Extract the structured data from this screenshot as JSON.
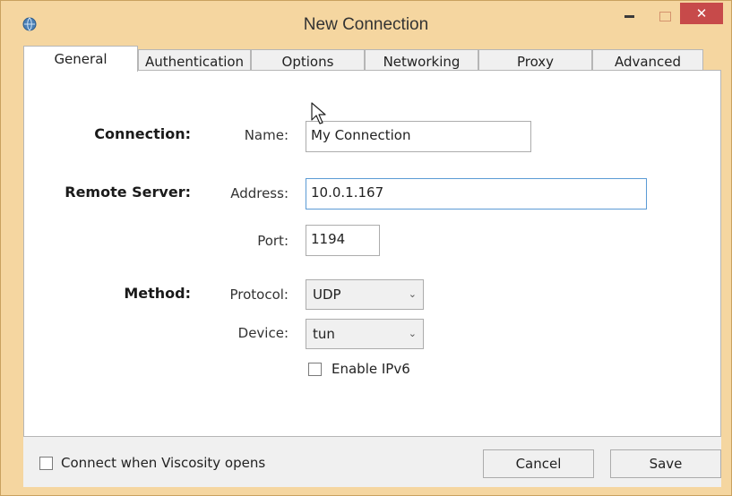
{
  "window": {
    "title": "New Connection",
    "close_glyph": "✕"
  },
  "tabs": [
    {
      "label": "General",
      "active": true
    },
    {
      "label": "Authentication",
      "active": false
    },
    {
      "label": "Options",
      "active": false
    },
    {
      "label": "Networking",
      "active": false
    },
    {
      "label": "Proxy",
      "active": false
    },
    {
      "label": "Advanced",
      "active": false
    }
  ],
  "connection": {
    "section_label": "Connection:",
    "name_label": "Name:",
    "name_value": "My Connection"
  },
  "remote_server": {
    "section_label": "Remote Server:",
    "address_label": "Address:",
    "address_value": "10.0.1.167",
    "port_label": "Port:",
    "port_value": "1194"
  },
  "method": {
    "section_label": "Method:",
    "protocol_label": "Protocol:",
    "protocol_value": "UDP",
    "device_label": "Device:",
    "device_value": "tun",
    "enable_ipv6_label": "Enable IPv6",
    "enable_ipv6_checked": false
  },
  "footer": {
    "connect_on_open_label": "Connect when Viscosity opens",
    "connect_on_open_checked": false,
    "cancel_label": "Cancel",
    "save_label": "Save"
  },
  "colors": {
    "titlebar": "#f5d6a0",
    "close_button": "#c74a4a",
    "focus_border": "#5b9bd5"
  },
  "icons": {
    "app": "globe-network-icon",
    "dropdown": "chevron-down-icon",
    "cursor": "mouse-pointer-icon"
  }
}
